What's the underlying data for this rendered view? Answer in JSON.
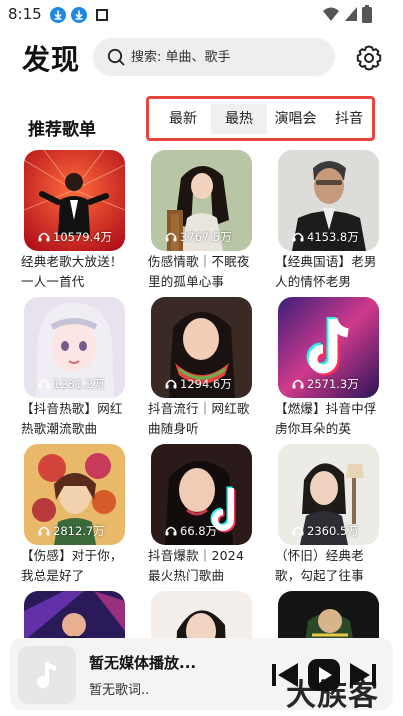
{
  "status_bar": {
    "time": "8:15",
    "icons_left": [
      "download-icon",
      "download-icon",
      "square-icon"
    ],
    "icons_right": [
      "wifi-icon",
      "signal-icon",
      "battery-icon"
    ]
  },
  "header": {
    "logo": "发现",
    "search_placeholder": "搜索: 单曲、歌手",
    "settings_icon": "gear-icon"
  },
  "section": {
    "title": "推荐歌单",
    "tabs": [
      {
        "label": "最新",
        "active": false
      },
      {
        "label": "最热",
        "active": true
      },
      {
        "label": "演唱会",
        "active": false
      },
      {
        "label": "抖音",
        "active": false
      }
    ]
  },
  "playlists": [
    {
      "plays": "10579.4万",
      "title": "经典老歌大放送！一人一首代"
    },
    {
      "plays": "3767.5万",
      "title": "伤感情歌｜不眠夜里的孤单心事"
    },
    {
      "plays": "4153.8万",
      "title": "【经典国语】老男人的情怀老男"
    },
    {
      "plays": "1231.2万",
      "title": "【抖音热歌】网红热歌潮流歌曲"
    },
    {
      "plays": "1294.6万",
      "title": "抖音流行｜网红歌曲随身听"
    },
    {
      "plays": "2571.3万",
      "title": "【燃爆】抖音中俘虏你耳朵的英"
    },
    {
      "plays": "2812.7万",
      "title": "【伤感】对于你，我总是好了"
    },
    {
      "plays": "66.8万",
      "title": "抖音爆款｜2024最火热门歌曲"
    },
    {
      "plays": "2360.5万",
      "title": "（怀旧）经典老歌，勾起了往事"
    },
    {
      "plays": "",
      "title": ""
    },
    {
      "plays": "",
      "title": ""
    },
    {
      "plays": "",
      "title": ""
    }
  ],
  "player": {
    "title": "暂无媒体播放...",
    "subtitle": "暂无歌词..",
    "controls": [
      "previous-icon",
      "play-icon",
      "next-icon"
    ]
  },
  "watermark": "大族客",
  "colors": {
    "tab_highlight_border": "#e8453c",
    "search_bg": "#eeeeee",
    "player_bg": "#f4f4f4"
  }
}
